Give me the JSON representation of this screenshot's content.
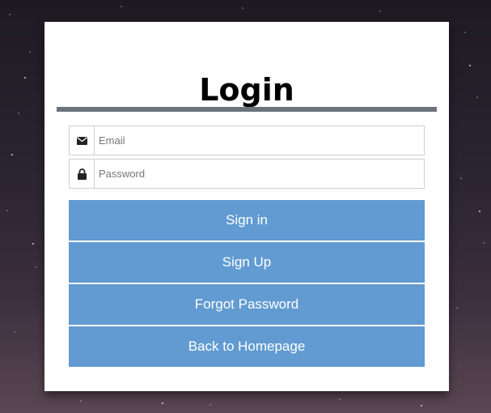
{
  "login": {
    "title": "Login",
    "email": {
      "placeholder": "Email",
      "value": "",
      "icon": "envelope-icon"
    },
    "password": {
      "placeholder": "Password",
      "value": "",
      "icon": "lock-icon"
    },
    "buttons": {
      "sign_in": "Sign in",
      "sign_up": "Sign Up",
      "forgot_password": "Forgot Password",
      "back_to_homepage": "Back to Homepage"
    }
  },
  "colors": {
    "button_bg": "#619bd1",
    "divider": "#6c737c",
    "card_bg": "#ffffff"
  }
}
